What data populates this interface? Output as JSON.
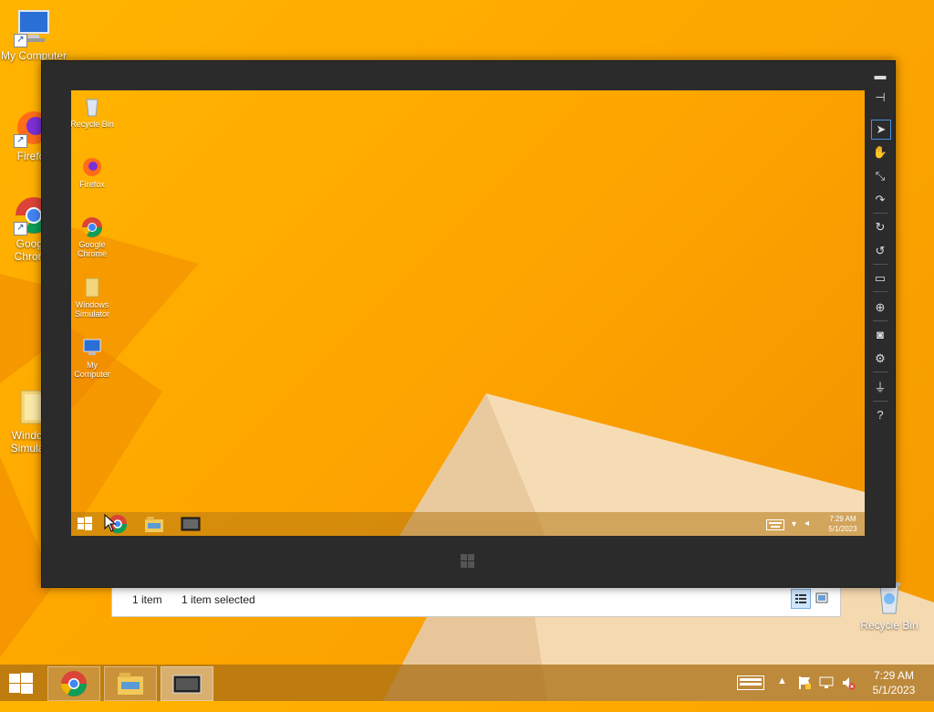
{
  "desktop": {
    "icons": [
      {
        "label": "My Computer"
      },
      {
        "label": "Firefox"
      },
      {
        "label": "Google Chrome"
      },
      {
        "label": "Windows Simulator"
      },
      {
        "label": "Recycle Bin"
      }
    ]
  },
  "explorer": {
    "item_count": "1 item",
    "selected": "1 item selected"
  },
  "simulator": {
    "desktop_icons": [
      {
        "label": "Recycle Bin"
      },
      {
        "label": "Firefox"
      },
      {
        "label": "Google Chrome"
      },
      {
        "label": "Windows Simulator"
      },
      {
        "label": "My Computer"
      }
    ],
    "clock_time": "7:29 AM",
    "clock_date": "5/1/2023",
    "toolbar": [
      "minimize-icon",
      "pin-icon",
      "mouse-mode-icon",
      "touch-mode-icon",
      "pinch-zoom-icon",
      "rotate-touch-icon",
      "rotate-clockwise-icon",
      "rotate-counterclockwise-icon",
      "resolution-icon",
      "location-icon",
      "screenshot-icon",
      "settings-icon",
      "network-icon",
      "help-icon"
    ]
  },
  "taskbar": {
    "clock_time": "7:29 AM",
    "clock_date": "5/1/2023"
  }
}
